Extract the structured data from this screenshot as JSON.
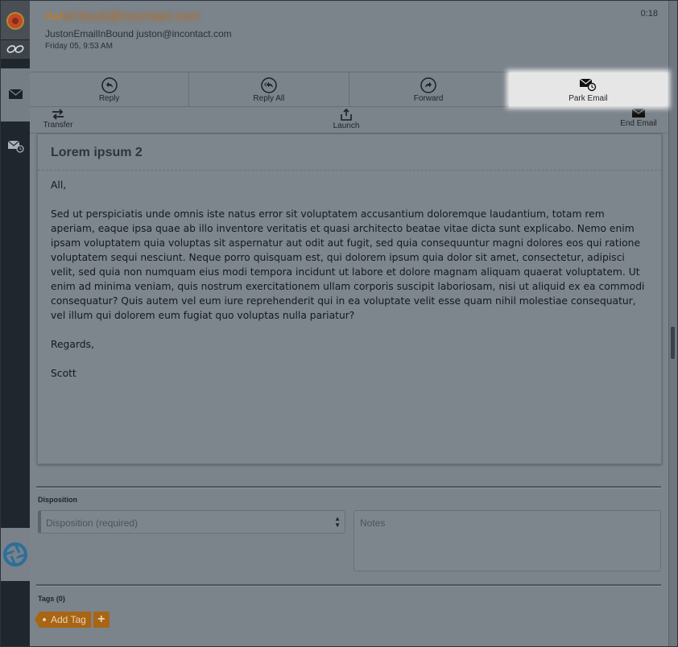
{
  "email": {
    "from_visible": "dar",
    "from_blurred": "iel.buck@incontact.com",
    "sender": "JustonEmailInBound  juston@incontact.com",
    "date": "Friday 05, 9:53 AM",
    "timer": "0:18",
    "subject": "Lorem ipsum 2",
    "body": [
      "All,",
      "Sed ut perspiciatis unde omnis iste natus error sit voluptatem accusantium doloremque laudantium, totam rem aperiam, eaque ipsa quae ab illo inventore veritatis et quasi architecto beatae vitae dicta sunt explicabo. Nemo enim ipsam voluptatem quia voluptas sit aspernatur aut odit aut fugit, sed quia consequuntur magni dolores eos qui ratione voluptatem sequi nesciunt. Neque porro quisquam est, qui dolorem ipsum quia dolor sit amet, consectetur, adipisci velit, sed quia non numquam eius modi tempora incidunt ut labore et dolore magnam aliquam quaerat voluptatem. Ut enim ad minima veniam, quis nostrum exercitationem ullam corporis suscipit laboriosam, nisi ut aliquid ex ea commodi consequatur? Quis autem vel eum iure reprehenderit qui in ea voluptate velit esse quam nihil molestiae consequatur, vel illum qui dolorem eum fugiat quo voluptas nulla pariatur?",
      "Regards,",
      "Scott"
    ]
  },
  "toolbar": {
    "reply": "Reply",
    "reply_all": "Reply All",
    "forward": "Forward",
    "park_email": "Park Email",
    "transfer": "Transfer",
    "launch": "Launch",
    "end_email": "End Email"
  },
  "disposition": {
    "label": "Disposition",
    "placeholder": "Disposition (required)",
    "notes_placeholder": "Notes"
  },
  "tags": {
    "label": "Tags (0)",
    "add_label": "Add Tag",
    "plus": "+"
  },
  "icons": [
    "status-icon",
    "link-icon",
    "mail-icon",
    "park-mail-icon",
    "app-logo-icon",
    "reply-icon",
    "reply-all-icon",
    "forward-icon",
    "park-email-icon",
    "transfer-icon",
    "launch-icon",
    "end-email-icon"
  ],
  "colors": {
    "accent": "#c67a1f",
    "tag_button": "#a96513",
    "rail": "#1f262e",
    "highlight": "#e6e6e6"
  }
}
